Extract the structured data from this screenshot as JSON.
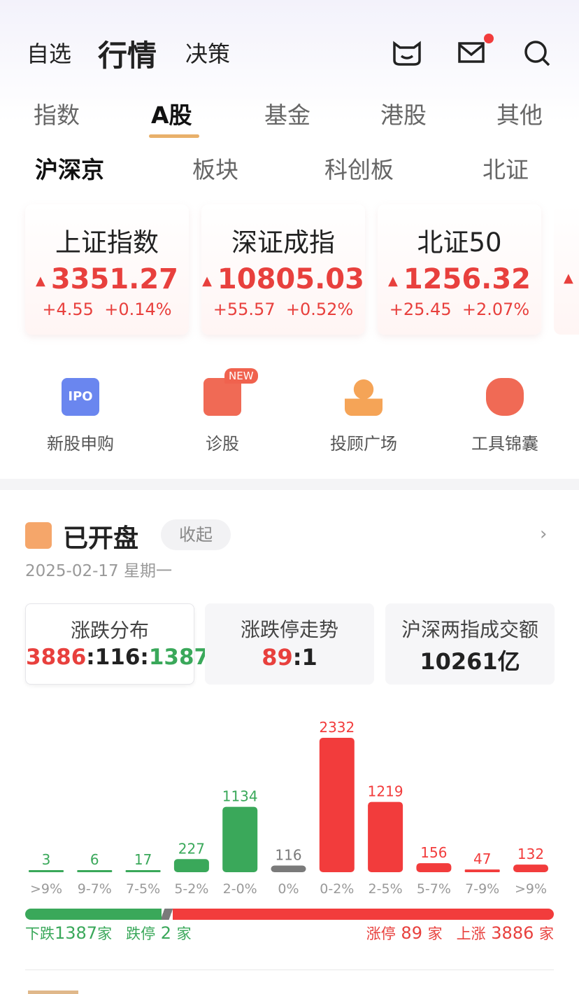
{
  "header": {
    "tabs": [
      "自选",
      "行情",
      "决策"
    ],
    "active": "行情",
    "icons": [
      "cat-icon",
      "mail-icon",
      "search-icon"
    ],
    "mail_badge": true
  },
  "market_tabs": {
    "items": [
      "指数",
      "A股",
      "基金",
      "港股",
      "其他"
    ],
    "active": "A股"
  },
  "sub_tabs": {
    "items": [
      "沪深京",
      "板块",
      "科创板",
      "北证"
    ],
    "active": "沪深京"
  },
  "index_cards": [
    {
      "name": "上证指数",
      "value": "3351.27",
      "change": "+4.55",
      "pct": "+0.14%",
      "trend": "up"
    },
    {
      "name": "深证成指",
      "value": "10805.03",
      "change": "+55.57",
      "pct": "+0.52%",
      "trend": "up"
    },
    {
      "name": "北证50",
      "value": "1256.32",
      "change": "+25.45",
      "pct": "+2.07%",
      "trend": "up"
    }
  ],
  "tools": [
    {
      "label": "新股申购",
      "icon": "ipo-calendar-icon",
      "icon_text": "IPO"
    },
    {
      "label": "诊股",
      "icon": "diagnose-icon",
      "badge": "NEW"
    },
    {
      "label": "投顾广场",
      "icon": "advisor-icon"
    },
    {
      "label": "工具锦囊",
      "icon": "toolbag-icon"
    }
  ],
  "market_status": {
    "title": "已开盘",
    "collapse": "收起",
    "date": "2025-02-17 星期一"
  },
  "stats": [
    {
      "title": "涨跌分布",
      "up": "3886",
      "flat": "116",
      "down": "1387"
    },
    {
      "title": "涨跌停走势",
      "up": "89",
      "down": "1"
    },
    {
      "title": "沪深两指成交额",
      "value": "10261亿"
    }
  ],
  "chart_data": {
    "type": "bar",
    "categories": [
      ">9%",
      "9-7%",
      "7-5%",
      "5-2%",
      "2-0%",
      "0%",
      "0-2%",
      "2-5%",
      "5-7%",
      "7-9%",
      ">9%"
    ],
    "values": [
      3,
      6,
      17,
      227,
      1134,
      116,
      2332,
      1219,
      156,
      47,
      132
    ],
    "colors": [
      "#3aa85a",
      "#3aa85a",
      "#3aa85a",
      "#3aa85a",
      "#3aa85a",
      "#7a7a7a",
      "#f23c3c",
      "#f23c3c",
      "#f23c3c",
      "#f23c3c",
      "#f23c3c"
    ]
  },
  "breadth": {
    "down_label": "下跌",
    "down": "1387",
    "limit_down_label": "跌停",
    "limit_down": "2",
    "limit_up_label": "涨停",
    "limit_up": "89",
    "up_label": "上涨",
    "up": "3886",
    "unit": "家",
    "down_fraction": 0.2575,
    "flat_fraction": 0.0215,
    "up_fraction": 0.721
  },
  "colors": {
    "up": "#f23c3c",
    "down": "#3aa85a",
    "flat": "#7a7a7a"
  }
}
